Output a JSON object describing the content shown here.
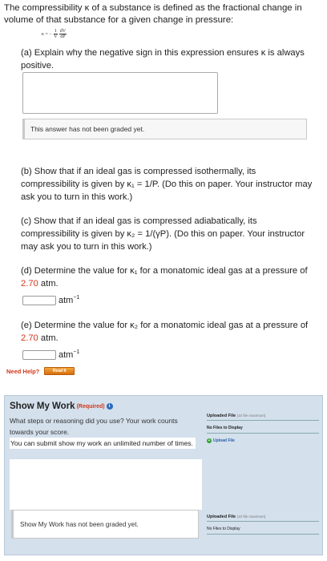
{
  "intro": "The compressibility κ of a substance is defined as the fractional change in volume of that substance for a given change in pressure:",
  "formula": {
    "lhs": "κ = −",
    "num1": "1",
    "den1": "V",
    "num2": "dV",
    "den2": "dP"
  },
  "part_a": "(a) Explain why the negative sign in this expression ensures κ is always positive.",
  "graded_msg": "This answer has not been graded yet.",
  "part_b": "(b) Show that if an ideal gas is compressed isothermally, its compressibility is given by κ₁ = 1/P. (Do this on paper. Your instructor may ask you to turn in this work.)",
  "part_c": "(c) Show that if an ideal gas is compressed adiabatically, its compressibility is given by κ₂ = 1/(γP). (Do this on paper. Your instructor may ask you to turn in this work.)",
  "part_d": {
    "pre": "(d) Determine the value for κ₁ for a monatomic ideal gas at a pressure of ",
    "value": "2.70",
    "post": " atm."
  },
  "part_e": {
    "pre": "(e) Determine the value for κ₂ for a monatomic ideal gas at a pressure of ",
    "value": "2.70",
    "post": " atm."
  },
  "unit": {
    "base": "atm",
    "exp": "−1"
  },
  "need_help": {
    "label": "Need Help?",
    "button": "Read It"
  },
  "work": {
    "title": "Show My Work",
    "required": "(Required)",
    "info_icon": "i",
    "question": "What steps or reasoning did you use? Your work counts towards your score.",
    "note": "You can submit show my work an unlimited number of times.",
    "graded": "Show My Work has not been graded yet.",
    "upload_title": "Uploaded File",
    "upload_small": "(10 file maximum)",
    "no_files": "No Files to Display",
    "upload_button": "Upload File",
    "upload_icon": "+"
  }
}
